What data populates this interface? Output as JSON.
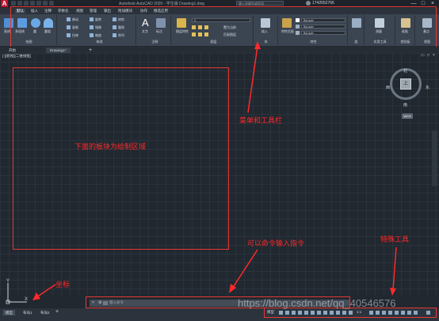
{
  "titlebar": {
    "app_logo": "A",
    "title": "Autodesk AutoCAD 2020 - 学生版   Drawing1.dwg",
    "search_placeholder": "键入关键字或短语",
    "user": "1742652766",
    "window_buttons": [
      "—",
      "□",
      "×"
    ]
  },
  "menu_tabs": [
    "默认",
    "插入",
    "注释",
    "参数化",
    "视图",
    "管理",
    "输出",
    "附加模块",
    "协作",
    "精选应用"
  ],
  "ribbon": {
    "draw": {
      "title": "绘图",
      "tools": [
        "直线",
        "多段线",
        "圆",
        "圆弧"
      ]
    },
    "modify": {
      "title": "修改",
      "tools": [
        "移动",
        "旋转",
        "修剪",
        "复制",
        "镜像",
        "圆角",
        "拉伸",
        "缩放",
        "阵列"
      ]
    },
    "annotation": {
      "title": "注释",
      "tools": [
        "文字",
        "标注"
      ]
    },
    "layers": {
      "title": "图层",
      "tools": [
        "图层特性"
      ],
      "layer_value": "0",
      "buttons": [
        "置为当前",
        "匹配图层"
      ]
    },
    "block": {
      "title": "块",
      "tools": [
        "插入"
      ]
    },
    "properties": {
      "title": "特性",
      "tools": [
        "特性匹配"
      ],
      "dropdowns": [
        "ByLayer",
        "ByLayer",
        "ByLayer"
      ]
    },
    "groups": {
      "title": "组"
    },
    "utilities": {
      "title": "实用工具",
      "tools": [
        "测量"
      ]
    },
    "clipboard": {
      "title": "剪贴板",
      "tools": [
        "粘贴"
      ]
    },
    "view": {
      "title": "视图",
      "tools": [
        "基点"
      ]
    }
  },
  "file_tabs": [
    "开始",
    "Drawing1*"
  ],
  "viewport_label": "[-][俯视][二维线框]",
  "viewcube": {
    "north": "北",
    "south": "南",
    "west": "西",
    "east": "东",
    "top": "上",
    "wcs": "WCS"
  },
  "annotations": {
    "ribbon": "菜单和工具栏",
    "drawing_area": "下面的板块为绘制区域",
    "command": "可以命令输入指令",
    "special_tools": "特殊工具",
    "coords": "坐标"
  },
  "command_line": {
    "placeholder": "键入命令"
  },
  "layout_tabs": [
    "模型",
    "布局1",
    "布局2"
  ],
  "statusbar": {
    "model": "模型",
    "scale": "1:1"
  },
  "ucs": {
    "x": "X",
    "y": "Y"
  },
  "watermark": "https://blog.csdn.net/qq_40546576"
}
